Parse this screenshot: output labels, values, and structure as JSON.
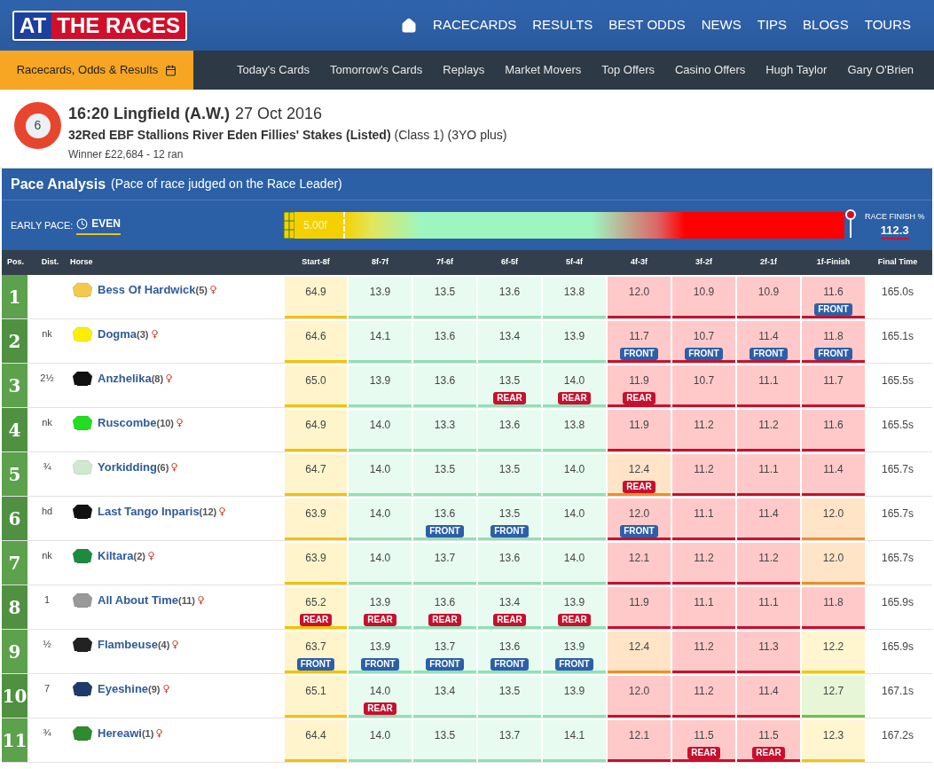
{
  "header": {
    "logo": {
      "part1": "AT",
      "part2": "THE RACES"
    },
    "nav": [
      "RACECARDS",
      "RESULTS",
      "BEST ODDS",
      "NEWS",
      "TIPS",
      "BLOGS",
      "TOURS"
    ]
  },
  "subnav": {
    "active": "Racecards, Odds & Results",
    "items": [
      "Today's Cards",
      "Tomorrow's Cards",
      "Replays",
      "Market Movers",
      "Top Offers",
      "Casino Offers",
      "Hugh Taylor",
      "Gary O'Brien"
    ]
  },
  "race": {
    "number": "6",
    "title": "16:20 Lingfield (A.W.)",
    "date": "27 Oct 2016",
    "name": "32Red EBF Stallions River Eden Fillies' Stakes (Listed)",
    "class": "(Class 1)",
    "age": "(3YO plus)",
    "winner": "Winner £22,684 - 12 ran"
  },
  "pace": {
    "title": "Pace Analysis",
    "subtitle": "(Pace of race judged on the Race Leader)",
    "early_label": "EARLY PACE:",
    "early_value": "EVEN",
    "distance": "5.00f",
    "finish_label": "RACE FINISH %",
    "finish_value": "112.3"
  },
  "table": {
    "columns": [
      "Pos.",
      "Dist.",
      "Horse",
      "Start-8f",
      "8f-7f",
      "7f-6f",
      "6f-5f",
      "5f-4f",
      "4f-3f",
      "3f-2f",
      "2f-1f",
      "1f-Finish",
      "Final Time"
    ],
    "rows": [
      {
        "cells": [
          {
            "kind": "pos",
            "value": "1"
          },
          {
            "kind": "dist"
          },
          {
            "kind": "horse",
            "name": "Bess Of Hardwick",
            "draw": "(5)",
            "color": "#f2c94c"
          },
          {
            "kind": "sector",
            "value": "64.9",
            "color": "#fff4cc"
          },
          {
            "kind": "sector",
            "value": "13.9",
            "color": "#e8fbf0"
          },
          {
            "kind": "sector",
            "value": "13.5",
            "color": "#e8fbf0"
          },
          {
            "kind": "sector",
            "value": "13.6",
            "color": "#e8fbf0"
          },
          {
            "kind": "sector",
            "value": "13.8",
            "color": "#e8fbf0"
          },
          {
            "kind": "sector",
            "value": "12.0",
            "color": "#ffc9c9"
          },
          {
            "kind": "sector",
            "value": "10.9",
            "color": "#ffc9c9"
          },
          {
            "kind": "sector",
            "value": "10.9",
            "color": "#ffc9c9"
          },
          {
            "kind": "sector",
            "value": "11.6",
            "color": "#ffc9c9",
            "tag": {
              "kind": "front",
              "label": "FRONT"
            }
          },
          {
            "kind": "final",
            "value": "165.0s"
          }
        ]
      },
      {
        "cells": [
          {
            "kind": "pos",
            "value": "2"
          },
          {
            "kind": "dist",
            "value": "nk"
          },
          {
            "kind": "horse",
            "name": "Dogma",
            "draw": "(3)",
            "color": "#ffee00"
          },
          {
            "kind": "sector",
            "value": "64.6",
            "color": "#fff4cc"
          },
          {
            "kind": "sector",
            "value": "14.1",
            "color": "#e8fbf0"
          },
          {
            "kind": "sector",
            "value": "13.6",
            "color": "#e8fbf0"
          },
          {
            "kind": "sector",
            "value": "13.4",
            "color": "#e8fbf0"
          },
          {
            "kind": "sector",
            "value": "13.9",
            "color": "#e8fbf0"
          },
          {
            "kind": "sector",
            "value": "11.7",
            "color": "#ffc9c9",
            "tag": {
              "kind": "front",
              "label": "FRONT"
            }
          },
          {
            "kind": "sector",
            "value": "10.7",
            "color": "#ffc9c9",
            "tag": {
              "kind": "front",
              "label": "FRONT"
            }
          },
          {
            "kind": "sector",
            "value": "11.4",
            "color": "#ffc9c9",
            "tag": {
              "kind": "front",
              "label": "FRONT"
            }
          },
          {
            "kind": "sector",
            "value": "11.8",
            "color": "#ffc9c9",
            "tag": {
              "kind": "front",
              "label": "FRONT"
            }
          },
          {
            "kind": "final",
            "value": "165.1s"
          }
        ]
      },
      {
        "cells": [
          {
            "kind": "pos",
            "value": "3"
          },
          {
            "kind": "dist",
            "value": "2½"
          },
          {
            "kind": "horse",
            "name": "Anzhelika",
            "draw": "(8)",
            "color": "#111111"
          },
          {
            "kind": "sector",
            "value": "65.0",
            "color": "#fff4cc"
          },
          {
            "kind": "sector",
            "value": "13.9",
            "color": "#e8fbf0"
          },
          {
            "kind": "sector",
            "value": "13.6",
            "color": "#e8fbf0"
          },
          {
            "kind": "sector",
            "value": "13.5",
            "color": "#e8fbf0",
            "tag": {
              "kind": "rear",
              "label": "REAR"
            }
          },
          {
            "kind": "sector",
            "value": "14.0",
            "color": "#e8fbf0",
            "tag": {
              "kind": "rear",
              "label": "REAR"
            }
          },
          {
            "kind": "sector",
            "value": "11.9",
            "color": "#ffc9c9",
            "tag": {
              "kind": "rear",
              "label": "REAR"
            }
          },
          {
            "kind": "sector",
            "value": "10.7",
            "color": "#ffc9c9"
          },
          {
            "kind": "sector",
            "value": "11.1",
            "color": "#ffc9c9"
          },
          {
            "kind": "sector",
            "value": "11.7",
            "color": "#ffc9c9"
          },
          {
            "kind": "final",
            "value": "165.5s"
          }
        ]
      },
      {
        "cells": [
          {
            "kind": "pos",
            "value": "4"
          },
          {
            "kind": "dist",
            "value": "nk"
          },
          {
            "kind": "horse",
            "name": "Ruscombe",
            "draw": "(10)",
            "color": "#22dd22"
          },
          {
            "kind": "sector",
            "value": "64.9",
            "color": "#fff4cc"
          },
          {
            "kind": "sector",
            "value": "14.0",
            "color": "#e8fbf0"
          },
          {
            "kind": "sector",
            "value": "13.3",
            "color": "#e8fbf0"
          },
          {
            "kind": "sector",
            "value": "13.6",
            "color": "#e8fbf0"
          },
          {
            "kind": "sector",
            "value": "13.8",
            "color": "#e8fbf0"
          },
          {
            "kind": "sector",
            "value": "11.9",
            "color": "#ffc9c9"
          },
          {
            "kind": "sector",
            "value": "11.2",
            "color": "#ffc9c9"
          },
          {
            "kind": "sector",
            "value": "11.2",
            "color": "#ffc9c9"
          },
          {
            "kind": "sector",
            "value": "11.6",
            "color": "#ffc9c9"
          },
          {
            "kind": "final",
            "value": "165.5s"
          }
        ]
      },
      {
        "cells": [
          {
            "kind": "pos",
            "value": "5"
          },
          {
            "kind": "dist",
            "value": "¾"
          },
          {
            "kind": "horse",
            "name": "Yorkidding",
            "draw": "(6)",
            "color": "#cfe8cf"
          },
          {
            "kind": "sector",
            "value": "64.7",
            "color": "#fff4cc"
          },
          {
            "kind": "sector",
            "value": "14.0",
            "color": "#e8fbf0"
          },
          {
            "kind": "sector",
            "value": "13.5",
            "color": "#e8fbf0"
          },
          {
            "kind": "sector",
            "value": "13.5",
            "color": "#e8fbf0"
          },
          {
            "kind": "sector",
            "value": "14.0",
            "color": "#e8fbf0"
          },
          {
            "kind": "sector",
            "value": "12.4",
            "color": "#ffe4c8",
            "tag": {
              "kind": "rear",
              "label": "REAR"
            }
          },
          {
            "kind": "sector",
            "value": "11.2",
            "color": "#ffc9c9"
          },
          {
            "kind": "sector",
            "value": "11.1",
            "color": "#ffc9c9"
          },
          {
            "kind": "sector",
            "value": "11.4",
            "color": "#ffc9c9"
          },
          {
            "kind": "final",
            "value": "165.7s"
          }
        ]
      },
      {
        "cells": [
          {
            "kind": "pos",
            "value": "6"
          },
          {
            "kind": "dist",
            "value": "hd"
          },
          {
            "kind": "horse",
            "name": "Last Tango Inparis",
            "draw": "(12)",
            "color": "#111111"
          },
          {
            "kind": "sector",
            "value": "63.9",
            "color": "#fff4cc"
          },
          {
            "kind": "sector",
            "value": "14.0",
            "color": "#e8fbf0"
          },
          {
            "kind": "sector",
            "value": "13.6",
            "color": "#e8fbf0",
            "tag": {
              "kind": "front",
              "label": "FRONT"
            }
          },
          {
            "kind": "sector",
            "value": "13.5",
            "color": "#e8fbf0",
            "tag": {
              "kind": "front",
              "label": "FRONT"
            }
          },
          {
            "kind": "sector",
            "value": "14.0",
            "color": "#e8fbf0"
          },
          {
            "kind": "sector",
            "value": "12.0",
            "color": "#ffc9c9",
            "tag": {
              "kind": "front",
              "label": "FRONT"
            }
          },
          {
            "kind": "sector",
            "value": "11.1",
            "color": "#ffc9c9"
          },
          {
            "kind": "sector",
            "value": "11.4",
            "color": "#ffc9c9"
          },
          {
            "kind": "sector",
            "value": "12.0",
            "color": "#ffe4c8"
          },
          {
            "kind": "final",
            "value": "165.7s"
          }
        ]
      },
      {
        "cells": [
          {
            "kind": "pos",
            "value": "7"
          },
          {
            "kind": "dist",
            "value": "nk"
          },
          {
            "kind": "horse",
            "name": "Kiltara",
            "draw": "(2)",
            "color": "#1e8a3e"
          },
          {
            "kind": "sector",
            "value": "63.9",
            "color": "#fff4cc"
          },
          {
            "kind": "sector",
            "value": "14.0",
            "color": "#e8fbf0"
          },
          {
            "kind": "sector",
            "value": "13.7",
            "color": "#e8fbf0"
          },
          {
            "kind": "sector",
            "value": "13.6",
            "color": "#e8fbf0"
          },
          {
            "kind": "sector",
            "value": "14.0",
            "color": "#e8fbf0"
          },
          {
            "kind": "sector",
            "value": "12.1",
            "color": "#ffc9c9"
          },
          {
            "kind": "sector",
            "value": "11.2",
            "color": "#ffc9c9"
          },
          {
            "kind": "sector",
            "value": "11.2",
            "color": "#ffc9c9"
          },
          {
            "kind": "sector",
            "value": "12.0",
            "color": "#ffe4c8"
          },
          {
            "kind": "final",
            "value": "165.7s"
          }
        ]
      },
      {
        "cells": [
          {
            "kind": "pos",
            "value": "8"
          },
          {
            "kind": "dist",
            "value": "1"
          },
          {
            "kind": "horse",
            "name": "All About Time",
            "draw": "(11)",
            "color": "#999999"
          },
          {
            "kind": "sector",
            "value": "65.2",
            "color": "#fff4cc",
            "tag": {
              "kind": "rear",
              "label": "REAR"
            }
          },
          {
            "kind": "sector",
            "value": "13.9",
            "color": "#e8fbf0",
            "tag": {
              "kind": "rear",
              "label": "REAR"
            }
          },
          {
            "kind": "sector",
            "value": "13.6",
            "color": "#e8fbf0",
            "tag": {
              "kind": "rear",
              "label": "REAR"
            }
          },
          {
            "kind": "sector",
            "value": "13.4",
            "color": "#e8fbf0",
            "tag": {
              "kind": "rear",
              "label": "REAR"
            }
          },
          {
            "kind": "sector",
            "value": "13.9",
            "color": "#e8fbf0",
            "tag": {
              "kind": "rear",
              "label": "REAR"
            }
          },
          {
            "kind": "sector",
            "value": "11.9",
            "color": "#ffc9c9"
          },
          {
            "kind": "sector",
            "value": "11.1",
            "color": "#ffc9c9"
          },
          {
            "kind": "sector",
            "value": "11.1",
            "color": "#ffc9c9"
          },
          {
            "kind": "sector",
            "value": "11.8",
            "color": "#ffc9c9"
          },
          {
            "kind": "final",
            "value": "165.9s"
          }
        ]
      },
      {
        "cells": [
          {
            "kind": "pos",
            "value": "9"
          },
          {
            "kind": "dist",
            "value": "½"
          },
          {
            "kind": "horse",
            "name": "Flambeuse",
            "draw": "(4)",
            "color": "#222222"
          },
          {
            "kind": "sector",
            "value": "63.7",
            "color": "#fff4cc",
            "tag": {
              "kind": "front",
              "label": "FRONT"
            }
          },
          {
            "kind": "sector",
            "value": "13.9",
            "color": "#e8fbf0",
            "tag": {
              "kind": "front",
              "label": "FRONT"
            }
          },
          {
            "kind": "sector",
            "value": "13.7",
            "color": "#e8fbf0",
            "tag": {
              "kind": "front",
              "label": "FRONT"
            }
          },
          {
            "kind": "sector",
            "value": "13.6",
            "color": "#e8fbf0",
            "tag": {
              "kind": "front",
              "label": "FRONT"
            }
          },
          {
            "kind": "sector",
            "value": "13.9",
            "color": "#e8fbf0",
            "tag": {
              "kind": "front",
              "label": "FRONT"
            }
          },
          {
            "kind": "sector",
            "value": "12.4",
            "color": "#ffe4c8"
          },
          {
            "kind": "sector",
            "value": "11.2",
            "color": "#ffc9c9"
          },
          {
            "kind": "sector",
            "value": "11.3",
            "color": "#ffc9c9"
          },
          {
            "kind": "sector",
            "value": "12.2",
            "color": "#fff6cf"
          },
          {
            "kind": "final",
            "value": "165.9s"
          }
        ]
      },
      {
        "cells": [
          {
            "kind": "pos",
            "value": "10"
          },
          {
            "kind": "dist",
            "value": "7"
          },
          {
            "kind": "horse",
            "name": "Eyeshine",
            "draw": "(9)",
            "color": "#1d3a6b"
          },
          {
            "kind": "sector",
            "value": "65.1",
            "color": "#fff4cc"
          },
          {
            "kind": "sector",
            "value": "14.0",
            "color": "#e8fbf0",
            "tag": {
              "kind": "rear",
              "label": "REAR"
            }
          },
          {
            "kind": "sector",
            "value": "13.4",
            "color": "#e8fbf0"
          },
          {
            "kind": "sector",
            "value": "13.5",
            "color": "#e8fbf0"
          },
          {
            "kind": "sector",
            "value": "13.9",
            "color": "#e8fbf0"
          },
          {
            "kind": "sector",
            "value": "12.0",
            "color": "#ffc9c9"
          },
          {
            "kind": "sector",
            "value": "11.2",
            "color": "#ffc9c9"
          },
          {
            "kind": "sector",
            "value": "11.4",
            "color": "#ffc9c9"
          },
          {
            "kind": "sector",
            "value": "12.7",
            "color": "#e6f6d6"
          },
          {
            "kind": "final",
            "value": "167.1s"
          }
        ]
      },
      {
        "cells": [
          {
            "kind": "pos",
            "value": "11"
          },
          {
            "kind": "dist",
            "value": "¾"
          },
          {
            "kind": "horse",
            "name": "Hereawi",
            "draw": "(1)",
            "color": "#2e8b2e"
          },
          {
            "kind": "sector",
            "value": "64.4",
            "color": "#fff4cc"
          },
          {
            "kind": "sector",
            "value": "14.0",
            "color": "#e8fbf0"
          },
          {
            "kind": "sector",
            "value": "13.5",
            "color": "#e8fbf0"
          },
          {
            "kind": "sector",
            "value": "13.7",
            "color": "#e8fbf0"
          },
          {
            "kind": "sector",
            "value": "14.1",
            "color": "#e8fbf0"
          },
          {
            "kind": "sector",
            "value": "12.1",
            "color": "#ffc9c9"
          },
          {
            "kind": "sector",
            "value": "11.5",
            "color": "#ffc9c9",
            "tag": {
              "kind": "rear",
              "label": "REAR"
            }
          },
          {
            "kind": "sector",
            "value": "11.5",
            "color": "#ffc9c9",
            "tag": {
              "kind": "rear",
              "label": "REAR"
            }
          },
          {
            "kind": "sector",
            "value": "12.3",
            "color": "#fff6cf"
          },
          {
            "kind": "final",
            "value": "167.2s"
          }
        ]
      }
    ]
  }
}
